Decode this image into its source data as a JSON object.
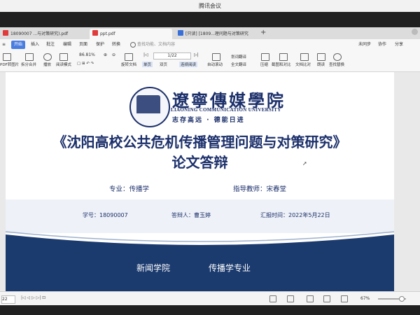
{
  "meeting": {
    "title": "腾讯会议"
  },
  "tabs": [
    {
      "label": "18090007 ...与对策研究).pdf",
      "color": "#e03a3a"
    },
    {
      "label": "ppt.pdf",
      "color": "#e03a3a"
    },
    {
      "label": "[只读] [1809...理问题与对策研究",
      "color": "#3a6fd8"
    }
  ],
  "menu": [
    "开始",
    "插入",
    "批注",
    "编辑",
    "页面",
    "保护",
    "转换"
  ],
  "menu_right": [
    "未同步",
    "协作",
    "分享"
  ],
  "search_placeholder": "查找功能、文档内容",
  "toolbar": {
    "items": [
      "PDF转图片",
      "拆分合并",
      "播放",
      "阅读模式",
      "旋转文档",
      "单页",
      "双页",
      "连续阅读",
      "自动滚动",
      "划词翻译",
      "全文翻译",
      "压缩",
      "截图和对比",
      "文档比对",
      "朗读",
      "查找替换"
    ],
    "zoom": "86.81%",
    "page": "1/22"
  },
  "slide": {
    "school_cn": "遼寧傳媒學院",
    "school_en": "LIAONING COMMUNICATION UNIVERSITY",
    "motto": "志存高远 · 德能日进",
    "title_line1": "《沈阳高校公共危机传播管理问题与对策研究》",
    "title_line2": "论文答辩",
    "major": "专业：传播学",
    "advisor": "指导教师：宋春堂",
    "student_id": "学号：18090007",
    "defender": "答辩人：曹玉婷",
    "date": "汇报时间：2022年5月22日",
    "college": "新闻学院",
    "major_footer": "传播学专业"
  },
  "status": {
    "page_input": "22",
    "zoom": "67%"
  }
}
